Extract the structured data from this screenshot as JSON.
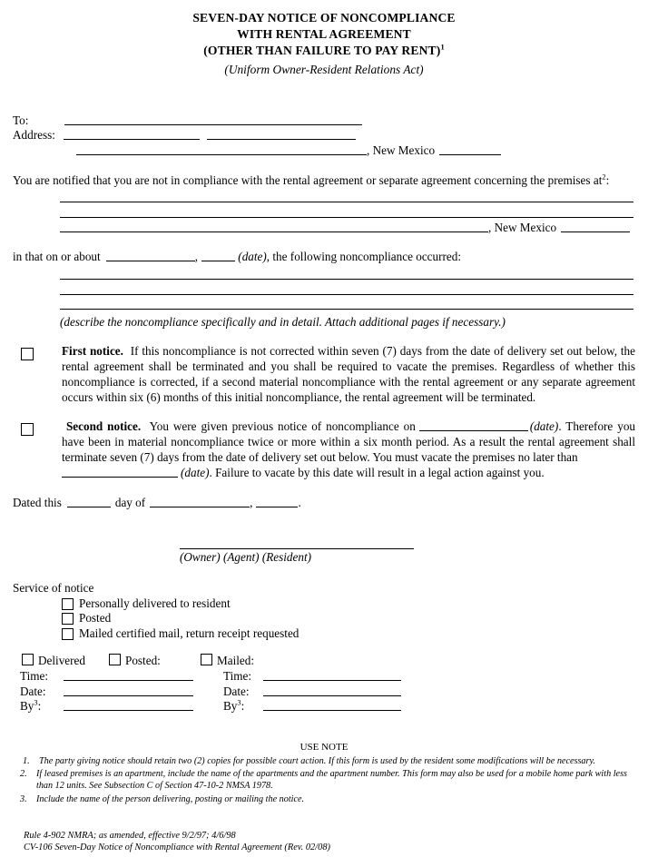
{
  "document": {
    "title_lines": [
      "SEVEN-DAY NOTICE OF NONCOMPLIANCE",
      "WITH RENTAL AGREEMENT",
      "(OTHER THAN FAILURE TO PAY RENT)"
    ],
    "title_footnote_marker": "1",
    "subtitle": "(Uniform Owner-Resident Relations Act)"
  },
  "recipient": {
    "to_label": "To:",
    "address_label": "Address:",
    "state_text": ", New Mexico"
  },
  "premises": {
    "intro": "You are notified that you are not in compliance with the rental agreement or separate agreement concerning the premises at",
    "footnote_marker": "2",
    "intro_colon": ":",
    "state_text": ", New Mexico"
  },
  "occurrence": {
    "lead": "in that on or about",
    "comma": ",",
    "date_label": "(date)",
    "tail": ", the following noncompliance occurred:",
    "instruction": "(describe the noncompliance specifically and in detail.  Attach additional pages if necessary.)"
  },
  "first_notice": {
    "heading": "First notice.",
    "text": "If this noncompliance is not corrected within seven (7) days from the date of delivery set out below, the rental agreement shall be terminated and you shall be required to vacate the premises.  Regardless of whether this noncompliance is corrected, if a second material noncompliance with the rental agreement or any separate agreement occurs within six (6) months of this initial noncompliance, the rental agreement will be terminated."
  },
  "second_notice": {
    "heading": "Second notice.",
    "text_part1": "You were given previous notice of noncompliance on",
    "date_label_1": "(date)",
    "text_part2": ".  Therefore you have been in material noncompliance twice or more within a six month period.  As a result the rental agreement shall terminate seven (7) days from the date of delivery set out below.  You must vacate the premises no later than",
    "date_label_2": "(date)",
    "text_part3": ".  Failure to vacate by this date will result in a legal action against you."
  },
  "dated": {
    "lead": "Dated this",
    "middle": "day of",
    "comma": ",",
    "period": ".",
    "signature_caption": "(Owner) (Agent) (Resident)"
  },
  "service": {
    "heading": "Service of notice",
    "options": [
      "Personally delivered to resident",
      "Posted",
      "Mailed certified mail, return receipt requested"
    ]
  },
  "delivery_blocks": {
    "checkboxes": [
      "Delivered",
      "Posted:",
      "Mailed:"
    ],
    "field_labels": [
      "Time:",
      "Date:",
      "By"
    ],
    "by_footnote_marker": "3",
    "colon": ":"
  },
  "use_note": {
    "heading": "USE NOTE",
    "items": [
      {
        "num": "1.",
        "text": "The party giving notice should retain two (2) copies for possible court action.  If this form is used by the resident some modifications will be necessary."
      },
      {
        "num": "2.",
        "text": "If leased premises is an apartment, include the name of the apartments and the apartment number. This form may also be used for a mobile home park with less than 12 units.  See Subsection C of Section 47-10-2 NMSA 1978."
      },
      {
        "num": "3.",
        "text": "Include the name of the person delivering, posting or mailing the notice."
      }
    ]
  },
  "footer": {
    "line1": "Rule 4-902 NMRA; as amended, effective 9/2/97; 4/6/98",
    "line2": "CV-106 Seven-Day Notice of Noncompliance with Rental Agreement (Rev. 02/08)"
  }
}
